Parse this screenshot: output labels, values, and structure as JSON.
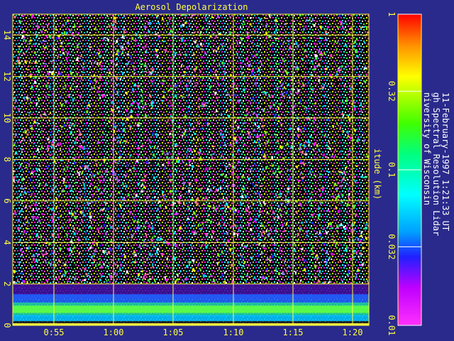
{
  "chart_data": {
    "type": "heatmap",
    "title": "Aerosol Depolarization",
    "xlabel": "",
    "ylabel": "itude (km)",
    "x_ticks": [
      "0:55",
      "1:00",
      "1:05",
      "1:10",
      "1:15",
      "1:20"
    ],
    "y_ticks": [
      "0",
      "2",
      "4",
      "6",
      "8",
      "10",
      "12",
      "14"
    ],
    "ylim": [
      0,
      15
    ],
    "grid": true,
    "colorbar": {
      "scale": "log",
      "range": [
        0.01,
        1
      ],
      "tick_labels": [
        "0.01",
        "0.032",
        "0.1",
        "0.32",
        "1"
      ]
    },
    "colors": {
      "background": "#2a2a8c",
      "grid": "#ffff40",
      "text": "#ffff40",
      "side_text": "#ffffff"
    }
  },
  "side_text": {
    "line1": "niversity of Wisconsin",
    "line2": "gh Spectral Resolution Lidar",
    "line3": "11-February-1997  1:21:33 UT"
  }
}
